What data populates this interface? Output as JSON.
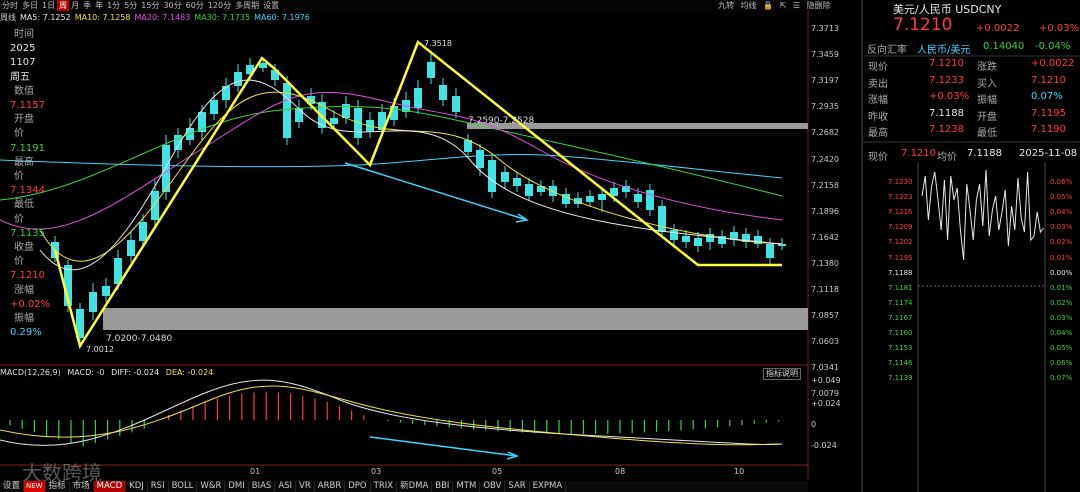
{
  "top_tabs": [
    "分时",
    "多日",
    "1日",
    "周",
    "月",
    "季",
    "年",
    "1分",
    "5分",
    "15分",
    "30分",
    "60分",
    "120分",
    "多周期",
    "设置"
  ],
  "top_tab_active_index": 3,
  "right_icons": {
    "jiu_zhuan": "九转",
    "jun_xian": "均线",
    "lock": "🔒",
    "expand": "⇱",
    "more": "☰",
    "min_label": "隐删除"
  },
  "ma_line": {
    "prefix": "周线",
    "items": [
      {
        "label": "MA5: 7.1252",
        "color": "#e6e6e6"
      },
      {
        "label": "MA10: 7.1258",
        "color": "#f1e041"
      },
      {
        "label": "MA20: 7.1483",
        "color": "#e44fe4"
      },
      {
        "label": "MA30: 7.1735",
        "color": "#3bd13b"
      },
      {
        "label": "MA60: 7.1976",
        "color": "#3cd6ff"
      }
    ]
  },
  "left_info": [
    {
      "text": "时间",
      "cls": "gray"
    },
    {
      "text": "2025",
      "cls": "white",
      "v": true
    },
    {
      "text": "1107",
      "cls": "white",
      "v": true
    },
    {
      "text": "周五",
      "cls": "white",
      "v": true
    },
    {
      "text": "数值",
      "cls": "gray"
    },
    {
      "text": "7.1157",
      "cls": "red",
      "v": true
    },
    {
      "text": "开盘价",
      "cls": "gray"
    },
    {
      "text": "7.1191",
      "cls": "green",
      "v": true
    },
    {
      "text": "最高价",
      "cls": "gray"
    },
    {
      "text": "7.1344",
      "cls": "red",
      "v": true
    },
    {
      "text": "最低价",
      "cls": "gray"
    },
    {
      "text": "7.1135",
      "cls": "green",
      "v": true
    },
    {
      "text": "收盘价",
      "cls": "gray"
    },
    {
      "text": "7.1210",
      "cls": "red",
      "v": true
    },
    {
      "text": "涨幅",
      "cls": "gray"
    },
    {
      "text": "+0.02%",
      "cls": "red",
      "v": true
    },
    {
      "text": "振幅",
      "cls": "gray"
    },
    {
      "text": "0.29%",
      "cls": "cyan",
      "v": true
    }
  ],
  "y_axis": [
    "7.3713",
    "7.3459",
    "7.3197",
    "7.2935",
    "7.2682",
    "7.2420",
    "7.2158",
    "7.1896",
    "7.1642",
    "7.1380",
    "7.1118",
    "7.0857",
    "7.0603",
    "7.0341",
    "7.0079"
  ],
  "annotations": {
    "high": "7.3518",
    "low": "7.0012",
    "zone_top": "7.2590-7.2528",
    "zone_bottom": "7.0200-7.0480"
  },
  "macd": {
    "name": "MACD(12,26,9)",
    "macd": "MACD: -0",
    "diff": "DIFF: -0.024",
    "dea": "DEA: -0.024",
    "btn": "指标说明",
    "y_axis": [
      "+0.049",
      "+0.024",
      "0",
      "-0.024"
    ]
  },
  "x_labels": [
    "01",
    "03",
    "05",
    "08",
    "10"
  ],
  "bottom_tabs": [
    "设置",
    "NEW",
    "指标",
    "市场",
    "MACD",
    "KDJ",
    "RSI",
    "BOLL",
    "W&R",
    "DMI",
    "BIAS",
    "ASI",
    "VR",
    "ARBR",
    "DPO",
    "TRIX",
    "新DMA",
    "BBI",
    "MTM",
    "OBV",
    "SAR",
    "EXPMA"
  ],
  "bottom_active": "MACD",
  "watermark": "大数跨境",
  "right_panel": {
    "title": "美元/人民币 USDCNY",
    "price": "7.1210",
    "change": "+0.0022",
    "change_pct": "+0.03%",
    "reverse_label": "反向汇率",
    "reverse_pair": "人民币/美元",
    "reverse_price": "0.14040",
    "reverse_pct": "-0.04%",
    "quote_rows": [
      [
        {
          "l": "现价",
          "v": "7.1210",
          "c": "red"
        },
        {
          "l": "涨跌",
          "v": "+0.0022",
          "c": "red"
        }
      ],
      [
        {
          "l": "卖出",
          "v": "7.1233",
          "c": "red"
        },
        {
          "l": "买入",
          "v": "7.1210",
          "c": "red"
        }
      ],
      [
        {
          "l": "涨幅",
          "v": "+0.03%",
          "c": "red"
        },
        {
          "l": "振幅",
          "v": "0.07%",
          "c": "cyan"
        }
      ],
      [
        {
          "l": "昨收",
          "v": "7.1188",
          "c": "white"
        },
        {
          "l": "开盘",
          "v": "7.1195",
          "c": "red"
        }
      ],
      [
        {
          "l": "最高",
          "v": "7.1238",
          "c": "red"
        },
        {
          "l": "最低",
          "v": "7.1190",
          "c": "red"
        }
      ]
    ],
    "mini_head": {
      "now_label": "现价",
      "now_val": "7.1210",
      "avg_label": "均价",
      "avg_val": "7.1188",
      "date": "2025-11-08"
    },
    "mini_y": [
      "7.1230",
      "7.1223",
      "7.1216",
      "7.1209",
      "7.1202",
      "7.1195",
      "7.1188",
      "7.1181",
      "7.1174",
      "7.1167",
      "7.1160",
      "7.1153",
      "7.1146",
      "7.1139"
    ],
    "mini_pct": [
      "0.06%",
      "0.05%",
      "0.04%",
      "0.03%",
      "0.02%",
      "0.01%",
      "0.00%",
      "0.01%",
      "0.02%",
      "0.03%",
      "0.04%",
      "0.05%",
      "0.06%",
      "0.07%"
    ]
  }
}
